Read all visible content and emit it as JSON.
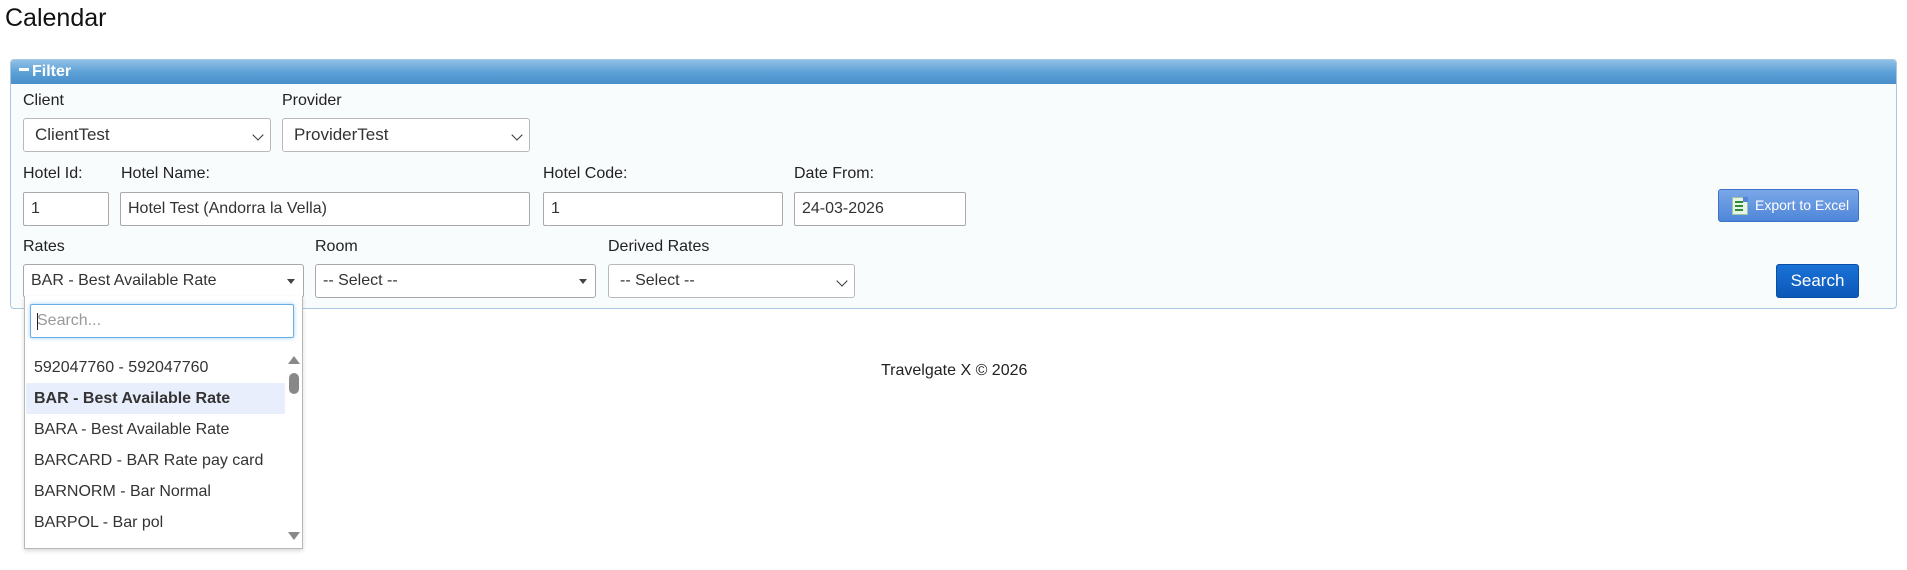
{
  "page": {
    "title": "Calendar"
  },
  "filter": {
    "header": "Filter",
    "client": {
      "label": "Client",
      "value": "ClientTest"
    },
    "provider": {
      "label": "Provider",
      "value": "ProviderTest"
    },
    "hotel_id": {
      "label": "Hotel Id:",
      "value": "1"
    },
    "hotel_name": {
      "label": "Hotel Name:",
      "value": "Hotel Test (Andorra la Vella)"
    },
    "hotel_code": {
      "label": "Hotel Code:",
      "value": "1"
    },
    "date_from": {
      "label": "Date From:",
      "value": "24-03-2026"
    },
    "rates": {
      "label": "Rates",
      "value": "BAR - Best Available Rate"
    },
    "room": {
      "label": "Room",
      "value": "-- Select --"
    },
    "derived_rates": {
      "label": "Derived Rates",
      "value": "-- Select --"
    },
    "export_button": "Export to Excel",
    "search_button": "Search"
  },
  "rates_dropdown": {
    "search_placeholder": "Search...",
    "items": [
      "592047760 - 592047760",
      "BAR - Best Available Rate",
      "BARA - Best Available Rate",
      "BARCARD - BAR Rate pay card",
      "BARNORM - Bar Normal",
      "BARPOL - Bar pol"
    ],
    "selected_index": 1
  },
  "footer": {
    "text": "Travelgate X © 2026"
  },
  "colors": {
    "accent": "#4a8fca",
    "search_button": "#0b58b8",
    "export_button": "#4f86d9"
  },
  "icons": {
    "export": "excel-icon",
    "collapse": "minus-icon"
  }
}
